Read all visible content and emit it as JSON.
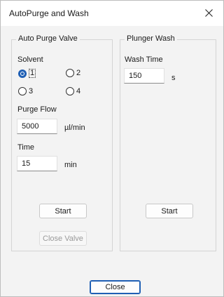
{
  "window": {
    "title": "AutoPurge and Wash"
  },
  "purge": {
    "group_label": "Auto Purge Valve",
    "solvent_label": "Solvent",
    "options": [
      "1",
      "2",
      "3",
      "4"
    ],
    "selected": "1",
    "flow_label": "Purge Flow",
    "flow_value": "5000",
    "flow_unit": "µl/min",
    "time_label": "Time",
    "time_value": "15",
    "time_unit": "min",
    "start_label": "Start",
    "close_valve_label": "Close Valve"
  },
  "wash": {
    "group_label": "Plunger Wash",
    "time_label": "Wash Time",
    "time_value": "150",
    "time_unit": "s",
    "start_label": "Start"
  },
  "footer": {
    "close_label": "Close"
  },
  "icons": {
    "close": "close-icon"
  }
}
